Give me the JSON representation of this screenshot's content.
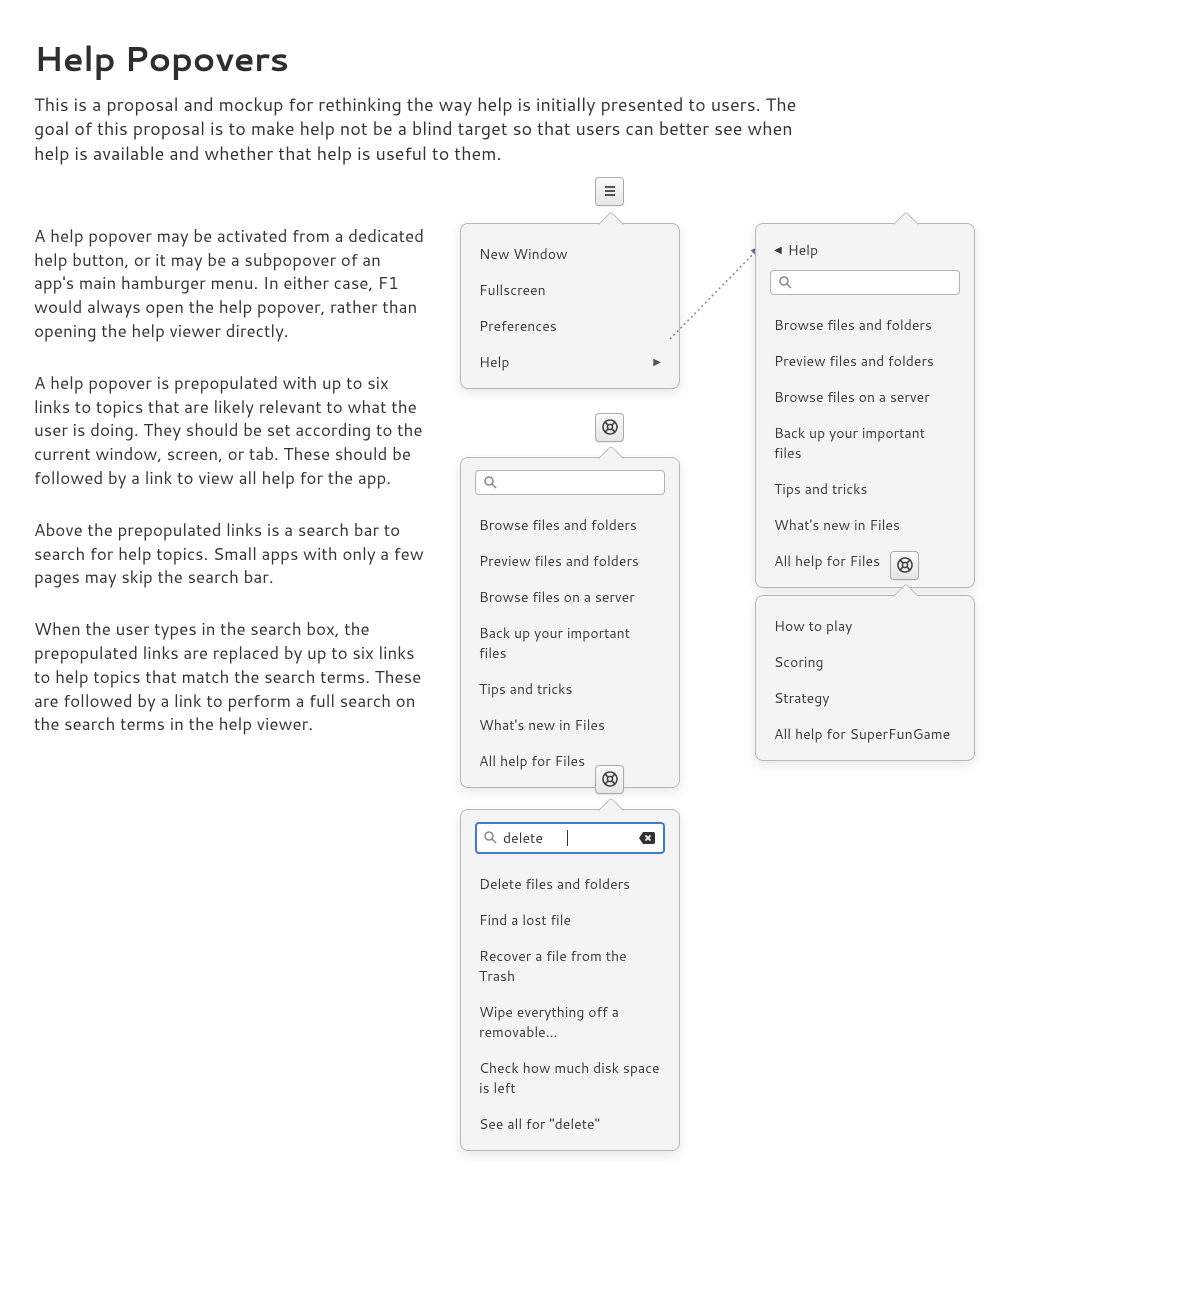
{
  "title": "Help Popovers",
  "intro": "This is a proposal and mockup for rethinking the way help is initially presented to users. The goal of this proposal is to make help not be a blind target so that users can better see when help is available and whether that help is useful to them.",
  "para1": "A help popover may be activated from a dedicated help button, or it may be a subpopover of an app's main hamburger menu. In either case, F1 would always open the help popover, rather than opening the help viewer directly.",
  "para2": "A help popover is prepopulated with up to six links to topics that are likely relevant to what the user is doing. They should be set according to the current window, screen, or tab. These should be followed by a link to view all help for the app.",
  "para3": "Above the prepopulated links is a search bar to search for help topics. Small apps with only a few pages may skip the search bar.",
  "para4": "When the user types in the search box, the prepopulated links are replaced by up to six links to help topics that match the search terms. These are followed by a link to perform a full search on the search terms in the help viewer.",
  "hamburger_menu": {
    "items": [
      "New Window",
      "Fullscreen",
      "Preferences",
      "Help"
    ]
  },
  "sub_popover": {
    "back_label": "Help",
    "items": [
      "Browse files and folders",
      "Preview files and folders",
      "Browse files on a server",
      "Back up your important files",
      "Tips and tricks",
      "What's new in Files",
      "All help for Files"
    ]
  },
  "help_popover_files": {
    "items": [
      "Browse files and folders",
      "Preview files and folders",
      "Browse files on a server",
      "Back up your important files",
      "Tips and tricks",
      "What's new in Files",
      "All help for Files"
    ]
  },
  "help_popover_game": {
    "items": [
      "How to play",
      "Scoring",
      "Strategy",
      "All help for SuperFunGame"
    ]
  },
  "search_popover": {
    "query": "delete",
    "items": [
      "Delete files and folders",
      "Find a lost file",
      "Recover a file from the Trash",
      "Wipe everything off a removable…",
      "Check how much disk space is left",
      "See all for \"delete\""
    ]
  }
}
